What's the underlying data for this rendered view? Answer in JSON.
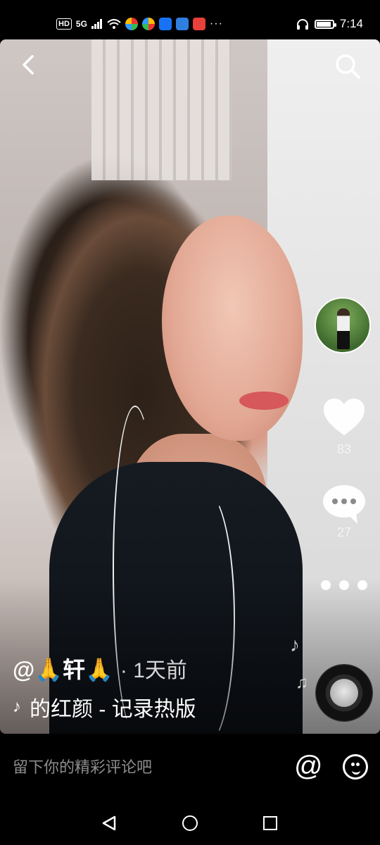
{
  "status_bar": {
    "network": "HD",
    "signal": "5G",
    "more": "···",
    "time": "7:14",
    "battery_level": 0.9
  },
  "video": {
    "author": "@🙏轩🙏",
    "posted": "· 1天前",
    "music": "的红颜 - 记录热版",
    "likes": "83",
    "comments": "27"
  },
  "comment_bar": {
    "placeholder": "留下你的精彩评论吧",
    "at_symbol": "@"
  },
  "colors": {
    "background": "#000000",
    "text": "#ffffff",
    "placeholder": "#8d8d8d"
  }
}
